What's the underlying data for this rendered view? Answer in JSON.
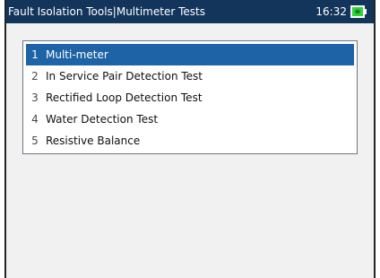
{
  "header": {
    "title": "Fault Isolation Tools|Multimeter Tests",
    "time": "16:32",
    "battery_icon": "battery-charging-icon",
    "battery_color": "#2fd23a"
  },
  "menu": {
    "items": [
      {
        "number": "1",
        "label": "Multi-meter",
        "selected": true
      },
      {
        "number": "2",
        "label": "In Service Pair Detection Test",
        "selected": false
      },
      {
        "number": "3",
        "label": "Rectified Loop Detection Test",
        "selected": false
      },
      {
        "number": "4",
        "label": "Water Detection Test",
        "selected": false
      },
      {
        "number": "5",
        "label": "Resistive Balance",
        "selected": false
      }
    ]
  },
  "colors": {
    "titlebar": "#13355c",
    "selection": "#1e63a5",
    "background": "#f1f1f1"
  }
}
